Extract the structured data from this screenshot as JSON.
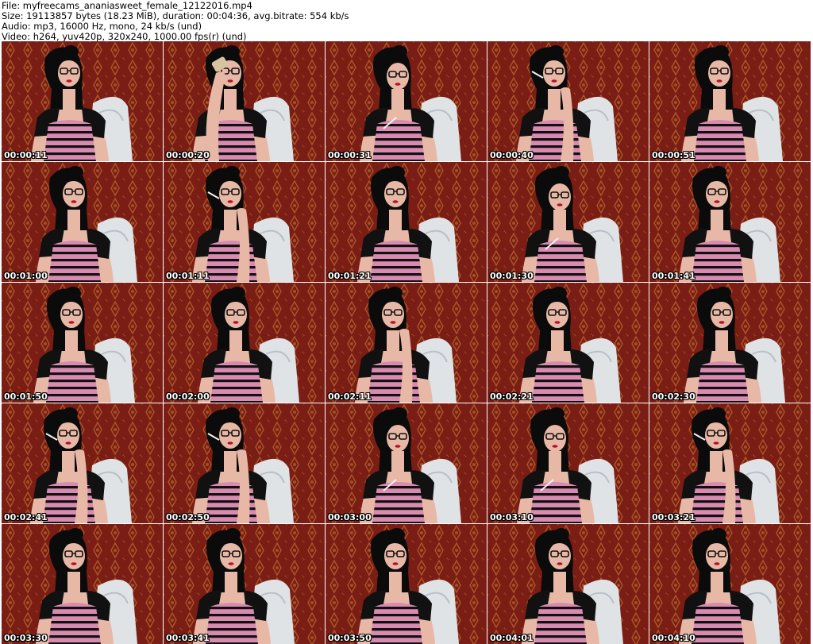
{
  "header": {
    "file_line": "File: myfreecams_ananiasweet_female_12122016.mp4",
    "size_line": "Size: 19113857 bytes (18.23 MiB), duration: 00:04:36, avg.bitrate: 554 kb/s",
    "audio_line": "Audio: mp3, 16000 Hz, mono, 24 kb/s (und)",
    "video_line": "Video: h264, yuv420p, 320x240, 1000.00 fps(r) (und)"
  },
  "thumbnails": [
    {
      "time": "00:00:11",
      "pose": "neutral"
    },
    {
      "time": "00:00:20",
      "pose": "drink"
    },
    {
      "time": "00:00:31",
      "pose": "down"
    },
    {
      "time": "00:00:40",
      "pose": "smoke"
    },
    {
      "time": "00:00:51",
      "pose": "neutral"
    },
    {
      "time": "00:01:00",
      "pose": "neutral"
    },
    {
      "time": "00:01:11",
      "pose": "smoke"
    },
    {
      "time": "00:01:21",
      "pose": "neutral"
    },
    {
      "time": "00:01:30",
      "pose": "down"
    },
    {
      "time": "00:01:41",
      "pose": "neutral"
    },
    {
      "time": "00:01:50",
      "pose": "neutral"
    },
    {
      "time": "00:02:00",
      "pose": "neutral"
    },
    {
      "time": "00:02:11",
      "pose": "hand"
    },
    {
      "time": "00:02:21",
      "pose": "neutral"
    },
    {
      "time": "00:02:30",
      "pose": "neutral"
    },
    {
      "time": "00:02:41",
      "pose": "smoke"
    },
    {
      "time": "00:02:50",
      "pose": "smoke"
    },
    {
      "time": "00:03:00",
      "pose": "down"
    },
    {
      "time": "00:03:10",
      "pose": "down"
    },
    {
      "time": "00:03:21",
      "pose": "smoke"
    },
    {
      "time": "00:03:30",
      "pose": "neutral"
    },
    {
      "time": "00:03:41",
      "pose": "neutral"
    },
    {
      "time": "00:03:50",
      "pose": "neutral"
    },
    {
      "time": "00:04:01",
      "pose": "neutral"
    },
    {
      "time": "00:04:10",
      "pose": "neutral"
    }
  ],
  "colors": {
    "wallpaper": "#7a1d14",
    "wallpaper_pattern": "#b5652e",
    "hair": "#0b0b0b",
    "skin": "#e8b8a6",
    "top_pink": "#d98ab0",
    "chair": "#dfe3e6"
  }
}
